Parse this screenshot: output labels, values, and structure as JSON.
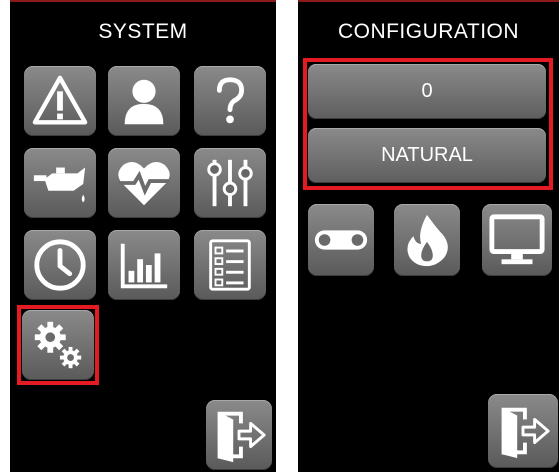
{
  "system_panel": {
    "title": "SYSTEM",
    "buttons": [
      {
        "icon": "warning-icon"
      },
      {
        "icon": "user-icon"
      },
      {
        "icon": "help-icon"
      },
      {
        "icon": "oil-can-icon"
      },
      {
        "icon": "heartbeat-icon"
      },
      {
        "icon": "sliders-icon"
      },
      {
        "icon": "clock-icon"
      },
      {
        "icon": "bar-chart-icon"
      },
      {
        "icon": "checklist-icon"
      },
      {
        "icon": "gears-icon",
        "selected": true
      },
      {
        "icon": "exit-icon"
      }
    ]
  },
  "configuration_panel": {
    "title": "CONFIGURATION",
    "fields": [
      {
        "value": "0"
      },
      {
        "value": "NATURAL"
      }
    ],
    "buttons": [
      {
        "icon": "conveyor-icon"
      },
      {
        "icon": "flame-icon"
      },
      {
        "icon": "monitor-icon"
      },
      {
        "icon": "exit-icon"
      }
    ]
  },
  "colors": {
    "background": "#000000",
    "button": "#707070",
    "selection": "#e41b23",
    "text": "#ffffff"
  }
}
